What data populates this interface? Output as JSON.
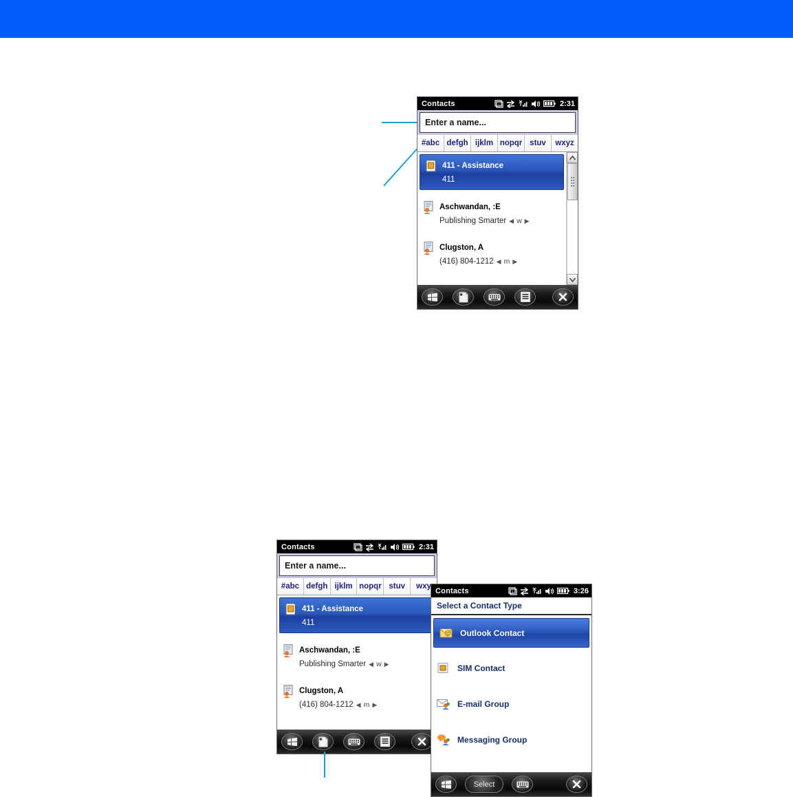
{
  "banner": {
    "color": "#005cfb"
  },
  "callout_color": "#1e9fd0",
  "device1": {
    "statusbar": {
      "title": "Contacts",
      "time": "2:31",
      "icons": [
        "messaging-icon",
        "connectivity-icon",
        "signal-icon",
        "speaker-icon",
        "battery-icon"
      ]
    },
    "search": {
      "value": "Enter a name...",
      "placeholder": "Enter a name..."
    },
    "tabs": [
      "#abc",
      "defgh",
      "ijklm",
      "nopqr",
      "stuv",
      "wxyz"
    ],
    "contacts": [
      {
        "name": "411 - Assistance",
        "detail": "411",
        "label": "",
        "icon": "sim-card-icon",
        "selected": true
      },
      {
        "name": "Aschwandan, :E",
        "detail": "Publishing Smarter",
        "label": "w",
        "icon": "contact-card-icon",
        "selected": false
      },
      {
        "name": "Clugston, A",
        "detail": "(416) 804-1212",
        "label": "m",
        "icon": "contact-card-icon",
        "selected": false
      }
    ],
    "softkeys": [
      "start-icon",
      "new-contact-icon",
      "keyboard-icon",
      "menu-icon",
      "close-icon"
    ]
  },
  "device2": {
    "statusbar": {
      "title": "Contacts",
      "time": "2:31",
      "icons": [
        "messaging-icon",
        "connectivity-icon",
        "signal-icon",
        "speaker-icon",
        "battery-icon"
      ]
    },
    "search": {
      "value": "Enter a name...",
      "placeholder": "Enter a name..."
    },
    "tabs": [
      "#abc",
      "defgh",
      "ijklm",
      "nopqr",
      "stuv",
      "wxy"
    ],
    "contacts": [
      {
        "name": "411 - Assistance",
        "detail": "411",
        "label": "",
        "icon": "sim-card-icon",
        "selected": true
      },
      {
        "name": "Aschwandan, :E",
        "detail": "Publishing Smarter",
        "label": "w",
        "icon": "contact-card-icon",
        "selected": false
      },
      {
        "name": "Clugston, A",
        "detail": "(416) 804-1212",
        "label": "m",
        "icon": "contact-card-icon",
        "selected": false
      }
    ],
    "softkeys": [
      "start-icon",
      "new-contact-icon",
      "keyboard-icon",
      "menu-icon",
      "close-icon"
    ]
  },
  "device3": {
    "statusbar": {
      "title": "Contacts",
      "time": "3:26",
      "icons": [
        "messaging-icon",
        "connectivity-icon",
        "signal-icon",
        "speaker-icon",
        "battery-icon"
      ]
    },
    "dialog_title": "Select a Contact Type",
    "types": [
      {
        "label": "Outlook Contact",
        "icon": "outlook-contact-icon",
        "selected": true
      },
      {
        "label": "SIM Contact",
        "icon": "sim-contact-icon",
        "selected": false
      },
      {
        "label": "E-mail Group",
        "icon": "email-group-icon",
        "selected": false
      },
      {
        "label": "Messaging Group",
        "icon": "messaging-group-icon",
        "selected": false
      }
    ],
    "softkeys": {
      "start": "start-icon",
      "select_label": "Select",
      "keyboard": "keyboard-icon",
      "close": "close-icon"
    }
  }
}
